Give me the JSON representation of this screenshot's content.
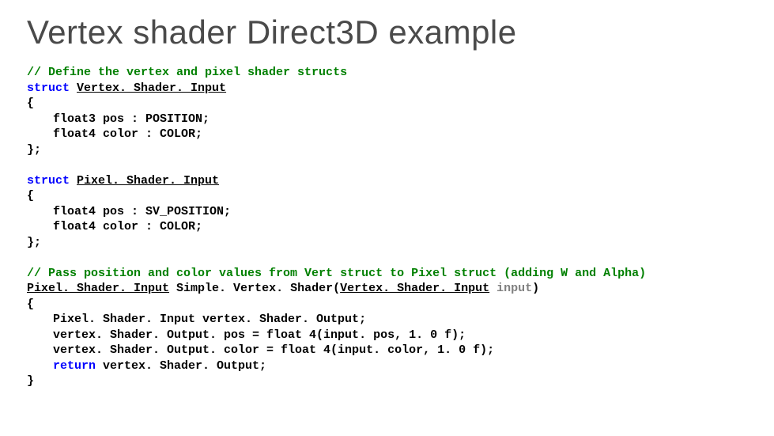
{
  "title": "Vertex shader Direct3D example",
  "code": {
    "c1": "// Define the vertex and pixel shader structs",
    "kw_struct": "struct",
    "t_vsi": "Vertex. Shader. Input",
    "l_open": "{",
    "l_vsi_pos": "float3 pos : POSITION;",
    "l_vsi_color": "float4 color : COLOR;",
    "l_close": "};",
    "t_psi": "Pixel. Shader. Input",
    "l_psi_pos": "float4 pos : SV_POSITION;",
    "l_psi_color": "float4 color : COLOR;",
    "c2": "// Pass position and color values from Vert struct to Pixel struct (adding W and Alpha)",
    "fn_ret": "Pixel. Shader. Input",
    "fn_name": "Simple. Vertex. Shader",
    "fn_paren_open": "(",
    "fn_param_type": "Vertex. Shader. Input",
    "fn_param_name": "input",
    "fn_paren_close": ")",
    "l_body_decl": "Pixel. Shader. Input vertex. Shader. Output;",
    "l_body_pos": "vertex. Shader. Output. pos = float 4(input. pos, 1. 0 f);",
    "l_body_color": "vertex. Shader. Output. color = float 4(input. color, 1. 0 f);",
    "kw_return": "return",
    "l_body_retexpr": " vertex. Shader. Output;",
    "l_fn_open": "{",
    "l_fn_close": "}"
  }
}
